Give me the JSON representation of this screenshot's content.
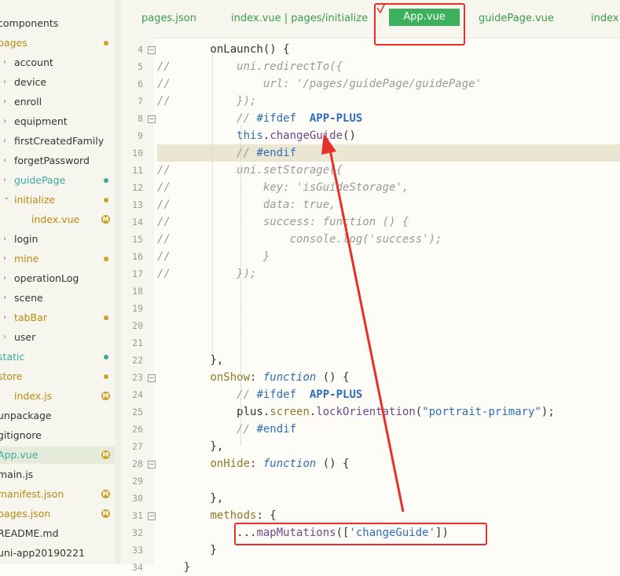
{
  "sidebar": {
    "items": [
      {
        "label": "components",
        "indent": 0,
        "chevron": false,
        "color": "#333333",
        "dot": null,
        "m": false
      },
      {
        "label": "pages",
        "indent": 0,
        "chevron": false,
        "color": "#b88a10",
        "dot": "#c9a227",
        "m": false
      },
      {
        "label": "account",
        "indent": 1,
        "chevron": true,
        "color": "#333333",
        "dot": null,
        "m": false
      },
      {
        "label": "device",
        "indent": 1,
        "chevron": true,
        "color": "#333333",
        "dot": null,
        "m": false
      },
      {
        "label": "enroll",
        "indent": 1,
        "chevron": true,
        "color": "#333333",
        "dot": null,
        "m": false
      },
      {
        "label": "equipment",
        "indent": 1,
        "chevron": true,
        "color": "#333333",
        "dot": null,
        "m": false
      },
      {
        "label": "firstCreatedFamily",
        "indent": 1,
        "chevron": true,
        "color": "#333333",
        "dot": null,
        "m": false
      },
      {
        "label": "forgetPassword",
        "indent": 1,
        "chevron": true,
        "color": "#333333",
        "dot": null,
        "m": false
      },
      {
        "label": "guidePage",
        "indent": 1,
        "chevron": true,
        "color": "#3aa9a0",
        "dot": "#3aa9a0",
        "m": false
      },
      {
        "label": "initialize",
        "indent": 1,
        "chevron": "open",
        "color": "#b88a10",
        "dot": "#c9a227",
        "m": false
      },
      {
        "label": "index.vue",
        "indent": 2,
        "chevron": false,
        "color": "#b88a10",
        "dot": null,
        "m": true
      },
      {
        "label": "login",
        "indent": 1,
        "chevron": true,
        "color": "#333333",
        "dot": null,
        "m": false
      },
      {
        "label": "mine",
        "indent": 1,
        "chevron": true,
        "color": "#b88a10",
        "dot": "#c9a227",
        "m": false
      },
      {
        "label": "operationLog",
        "indent": 1,
        "chevron": true,
        "color": "#333333",
        "dot": null,
        "m": false
      },
      {
        "label": "scene",
        "indent": 1,
        "chevron": true,
        "color": "#333333",
        "dot": null,
        "m": false
      },
      {
        "label": "tabBar",
        "indent": 1,
        "chevron": true,
        "color": "#b88a10",
        "dot": "#c9a227",
        "m": false
      },
      {
        "label": "user",
        "indent": 1,
        "chevron": true,
        "color": "#333333",
        "dot": null,
        "m": false
      },
      {
        "label": "static",
        "indent": 0,
        "chevron": false,
        "color": "#3aa9a0",
        "dot": "#3aa9a0",
        "m": false
      },
      {
        "label": "store",
        "indent": 0,
        "chevron": false,
        "color": "#b88a10",
        "dot": "#c9a227",
        "m": false
      },
      {
        "label": "index.js",
        "indent": 1,
        "chevron": false,
        "color": "#b88a10",
        "dot": null,
        "m": true
      },
      {
        "label": "unpackage",
        "indent": 0,
        "chevron": false,
        "color": "#333333",
        "dot": null,
        "m": false
      },
      {
        "label": "gitignore",
        "indent": 0,
        "chevron": false,
        "color": "#333333",
        "dot": null,
        "m": false
      },
      {
        "label": "App.vue",
        "indent": 0,
        "chevron": false,
        "color": "#3aa9a0",
        "dot": null,
        "m": true,
        "active": true
      },
      {
        "label": "main.js",
        "indent": 0,
        "chevron": false,
        "color": "#333333",
        "dot": null,
        "m": false
      },
      {
        "label": "manifest.json",
        "indent": 0,
        "chevron": false,
        "color": "#b88a10",
        "dot": null,
        "m": true
      },
      {
        "label": "pages.json",
        "indent": 0,
        "chevron": false,
        "color": "#b88a10",
        "dot": null,
        "m": true
      },
      {
        "label": "README.md",
        "indent": 0,
        "chevron": false,
        "color": "#333333",
        "dot": null,
        "m": false
      },
      {
        "label": "uni-app20190221",
        "indent": 0,
        "chevron": false,
        "color": "#333333",
        "dot": null,
        "m": false
      }
    ],
    "m_badge": "M"
  },
  "tabs": {
    "items": [
      "pages.json",
      "index.vue | pages/initialize",
      "guidePage.vue",
      "index."
    ],
    "active": "App.vue"
  },
  "editor": {
    "lines": [
      {
        "n": "4",
        "fold": true,
        "parts": [
          [
            "plain",
            "        onLaunch() {"
          ]
        ]
      },
      {
        "n": "5",
        "fold": false,
        "parts": [
          [
            "cm",
            "//          uni.redirectTo({"
          ]
        ]
      },
      {
        "n": "6",
        "fold": false,
        "parts": [
          [
            "cm",
            "//              url: '/pages/guidePage/guidePage'"
          ]
        ]
      },
      {
        "n": "7",
        "fold": false,
        "parts": [
          [
            "cm",
            "//          });"
          ]
        ]
      },
      {
        "n": "8",
        "fold": true,
        "parts": [
          [
            "cm",
            "            // "
          ],
          [
            "dir",
            "#ifdef"
          ],
          [
            "plain",
            "  "
          ],
          [
            "kw",
            "APP-PLUS"
          ]
        ]
      },
      {
        "n": "9",
        "fold": false,
        "parts": [
          [
            "plain",
            "            "
          ],
          [
            "str",
            "this"
          ],
          [
            "plain",
            "."
          ],
          [
            "fn",
            "changeGuide"
          ],
          [
            "plain",
            "()"
          ]
        ]
      },
      {
        "n": "10",
        "fold": false,
        "current": true,
        "parts": [
          [
            "cm",
            "            // "
          ],
          [
            "dir",
            "#endif"
          ]
        ]
      },
      {
        "n": "11",
        "fold": false,
        "parts": [
          [
            "cm",
            "//          uni.setStorage({"
          ]
        ]
      },
      {
        "n": "12",
        "fold": false,
        "parts": [
          [
            "cm",
            "//              key: 'isGuideStorage',"
          ]
        ]
      },
      {
        "n": "13",
        "fold": false,
        "parts": [
          [
            "cm",
            "//              data: true,"
          ]
        ]
      },
      {
        "n": "14",
        "fold": false,
        "parts": [
          [
            "cm",
            "//              success: function () {"
          ]
        ]
      },
      {
        "n": "15",
        "fold": false,
        "parts": [
          [
            "cm",
            "//                  console.log('success');"
          ]
        ]
      },
      {
        "n": "16",
        "fold": false,
        "parts": [
          [
            "cm",
            "//              }"
          ]
        ]
      },
      {
        "n": "17",
        "fold": false,
        "parts": [
          [
            "cm",
            "//          });"
          ]
        ]
      },
      {
        "n": "18",
        "fold": false,
        "parts": []
      },
      {
        "n": "19",
        "fold": false,
        "parts": []
      },
      {
        "n": "20",
        "fold": false,
        "parts": []
      },
      {
        "n": "21",
        "fold": false,
        "parts": []
      },
      {
        "n": "22",
        "fold": false,
        "parts": [
          [
            "plain",
            "        },"
          ]
        ]
      },
      {
        "n": "23",
        "fold": true,
        "parts": [
          [
            "plain",
            "        "
          ],
          [
            "prop",
            "onShow"
          ],
          [
            "plain",
            ": "
          ],
          [
            "it",
            "function"
          ],
          [
            "plain",
            " () {"
          ]
        ]
      },
      {
        "n": "24",
        "fold": false,
        "parts": [
          [
            "cm",
            "            // "
          ],
          [
            "dir",
            "#ifdef"
          ],
          [
            "plain",
            "  "
          ],
          [
            "kw",
            "APP-PLUS"
          ]
        ]
      },
      {
        "n": "25",
        "fold": false,
        "parts": [
          [
            "plain",
            "            plus."
          ],
          [
            "prop",
            "screen"
          ],
          [
            "plain",
            "."
          ],
          [
            "fn",
            "lockOrientation"
          ],
          [
            "plain",
            "("
          ],
          [
            "str",
            "\"portrait-primary\""
          ],
          [
            "plain",
            ");"
          ]
        ]
      },
      {
        "n": "26",
        "fold": false,
        "parts": [
          [
            "cm",
            "            // "
          ],
          [
            "dir",
            "#endif"
          ]
        ]
      },
      {
        "n": "27",
        "fold": false,
        "parts": [
          [
            "plain",
            "        },"
          ]
        ]
      },
      {
        "n": "28",
        "fold": true,
        "parts": [
          [
            "plain",
            "        "
          ],
          [
            "prop",
            "onHide"
          ],
          [
            "plain",
            ": "
          ],
          [
            "it",
            "function"
          ],
          [
            "plain",
            " () {"
          ]
        ]
      },
      {
        "n": "29",
        "fold": false,
        "parts": []
      },
      {
        "n": "30",
        "fold": false,
        "parts": [
          [
            "plain",
            "        },"
          ]
        ]
      },
      {
        "n": "31",
        "fold": true,
        "parts": [
          [
            "plain",
            "        "
          ],
          [
            "prop",
            "methods"
          ],
          [
            "plain",
            ": {"
          ]
        ]
      },
      {
        "n": "32",
        "fold": false,
        "parts": [
          [
            "plain",
            "            ..."
          ],
          [
            "fn",
            "mapMutations"
          ],
          [
            "plain",
            "(["
          ],
          [
            "str",
            "'changeGuide'"
          ],
          [
            "plain",
            "])"
          ]
        ]
      },
      {
        "n": "33",
        "fold": false,
        "parts": [
          [
            "plain",
            "        }"
          ]
        ]
      },
      {
        "n": "34",
        "fold": false,
        "parts": [
          [
            "plain",
            "    }"
          ]
        ]
      }
    ]
  },
  "colors": {
    "accent": "#3cb05a",
    "highlight": "#e8302a"
  }
}
